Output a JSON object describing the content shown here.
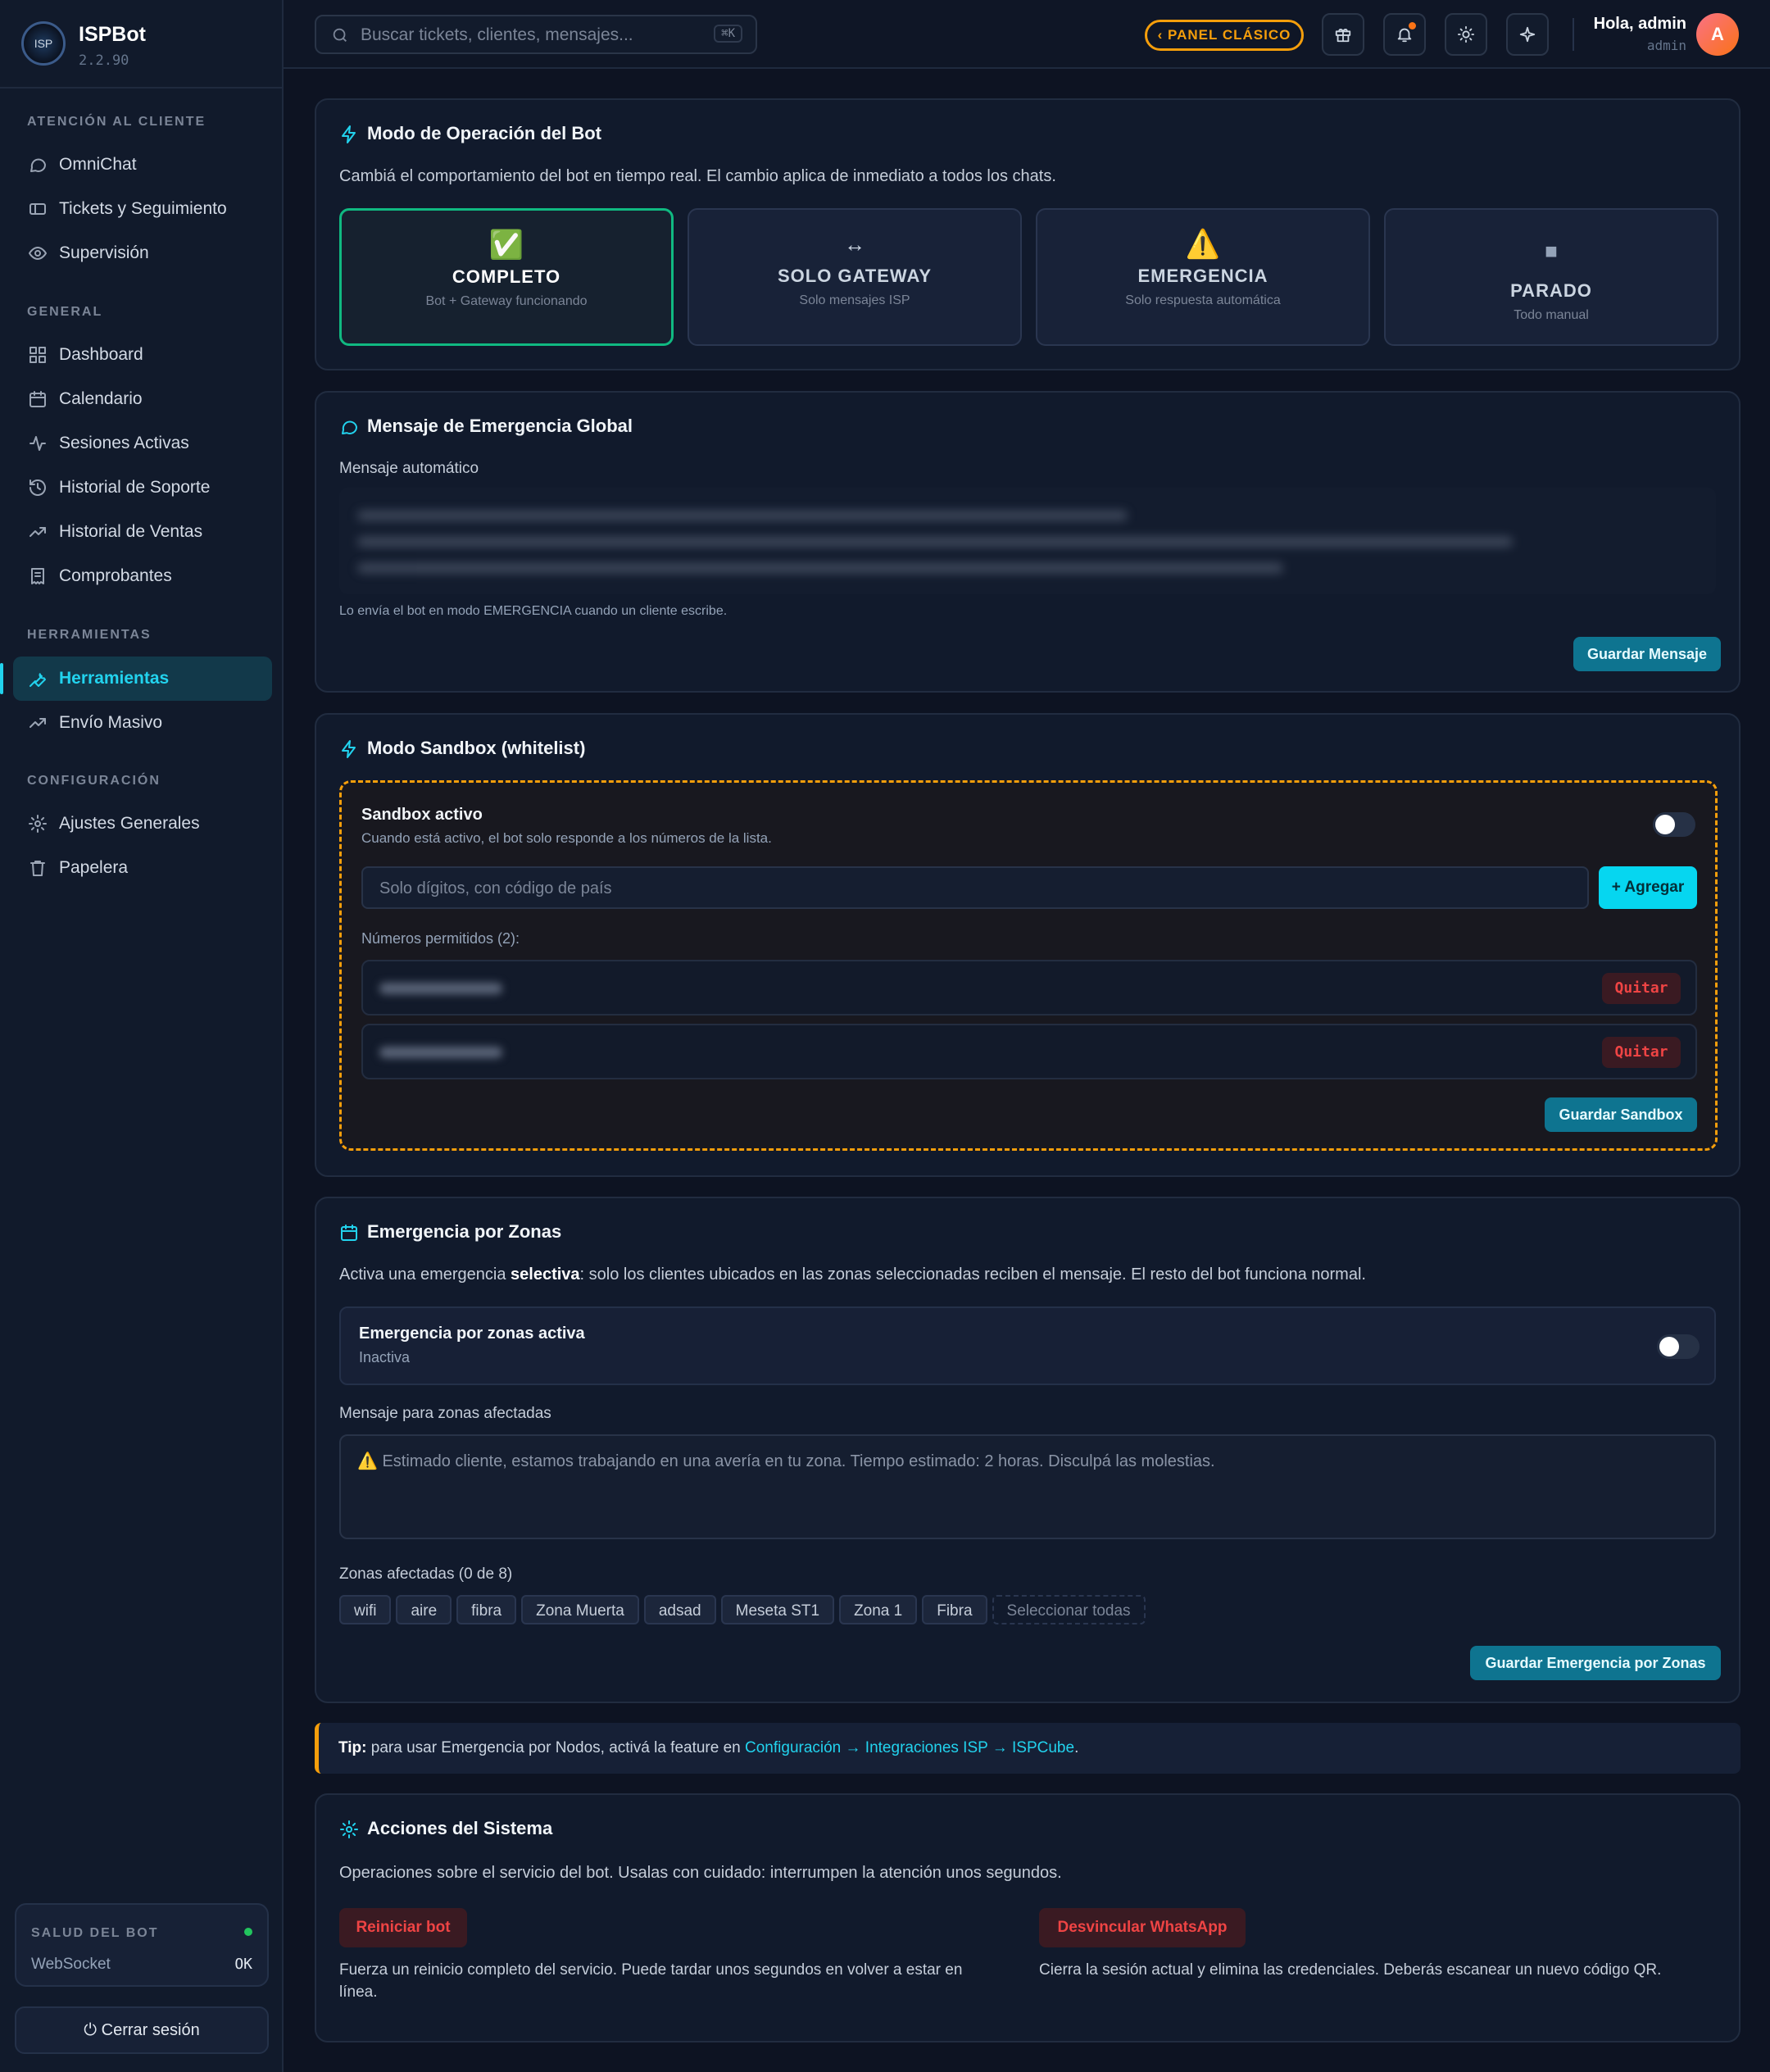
{
  "app": {
    "name": "ISPBot",
    "version": "2.2.90"
  },
  "sidebar": {
    "sections": [
      {
        "title": "ATENCIÓN AL CLIENTE",
        "items": [
          "OmniChat",
          "Tickets y Seguimiento",
          "Supervisión"
        ]
      },
      {
        "title": "GENERAL",
        "items": [
          "Dashboard",
          "Calendario",
          "Sesiones Activas",
          "Historial de Soporte",
          "Historial de Ventas",
          "Comprobantes"
        ]
      },
      {
        "title": "HERRAMIENTAS",
        "items": [
          "Herramientas",
          "Envío Masivo"
        ]
      },
      {
        "title": "CONFIGURACIÓN",
        "items": [
          "Ajustes Generales",
          "Papelera"
        ]
      }
    ],
    "active_item": "Herramientas",
    "health": {
      "title": "SALUD DEL BOT",
      "key": "WebSocket",
      "value": "OK",
      "status_color": "#22c55e"
    },
    "logout": "⏻ Cerrar sesión"
  },
  "topbar": {
    "search_placeholder": "Buscar tickets, clientes, mensajes...",
    "shortcut": "⌘K",
    "classic_panel": "‹ PANEL CLÁSICO",
    "greeting": "Hola, admin",
    "username": "admin",
    "avatar_letter": "A",
    "icons": [
      "gift-icon",
      "bell-icon",
      "sun-icon",
      "sparkle-icon"
    ]
  },
  "mode_card": {
    "title": "Modo de Operación del Bot",
    "description": "Cambiá el comportamiento del bot en tiempo real. El cambio aplica de inmediato a todos los chats.",
    "modes": [
      {
        "icon": "✅",
        "name": "COMPLETO",
        "sub": "Bot + Gateway funcionando",
        "selected": true
      },
      {
        "icon": "↔",
        "name": "SOLO GATEWAY",
        "sub": "Solo mensajes ISP",
        "selected": false
      },
      {
        "icon": "⚠️",
        "name": "EMERGENCIA",
        "sub": "Solo respuesta automática",
        "selected": false
      },
      {
        "icon": "■",
        "name": "PARADO",
        "sub": "Todo manual",
        "selected": false
      }
    ]
  },
  "emergency_card": {
    "title": "Mensaje de Emergencia Global",
    "label": "Mensaje automático",
    "help": "Lo envía el bot en modo EMERGENCIA cuando un cliente escribe.",
    "save": "Guardar Mensaje"
  },
  "sandbox_card": {
    "title": "Modo Sandbox (whitelist)",
    "toggle_title": "Sandbox activo",
    "toggle_desc": "Cuando está activo, el bot solo responde a los números de la lista.",
    "input_placeholder": "Solo dígitos, con código de país",
    "add": "+ Agregar",
    "allowed_label": "Números permitidos (2):",
    "remove": "Quitar",
    "save": "Guardar Sandbox",
    "accent": "#f59e0b"
  },
  "zones_card": {
    "title": "Emergencia por Zonas",
    "desc_pre": "Activa una emergencia ",
    "desc_bold": "selectiva",
    "desc_post": ": solo los clientes ubicados en las zonas seleccionadas reciben el mensaje. El resto del bot funciona normal.",
    "toggle_title": "Emergencia por zonas activa",
    "toggle_status": "Inactiva",
    "msg_label": "Mensaje para zonas afectadas",
    "msg_placeholder": "⚠️ Estimado cliente, estamos trabajando en una avería en tu zona. Tiempo estimado: 2 horas. Disculpá las molestias.",
    "zones_label": "Zonas afectadas (0 de 8)",
    "zones": [
      "wifi",
      "aire",
      "fibra",
      "Zona Muerta",
      "adsad",
      "Meseta ST1",
      "Zona 1",
      "Fibra"
    ],
    "select_all": "Seleccionar todas",
    "save": "Guardar Emergencia por Zonas"
  },
  "tip": {
    "bold": "Tip:",
    "text": " para usar Emergencia por Nodos, activá la feature en ",
    "link": "Configuración → Integraciones ISP → ISPCube",
    "end": "."
  },
  "actions_card": {
    "title": "Acciones del Sistema",
    "description": "Operaciones sobre el servicio del bot. Usalas con cuidado: interrumpen la atención unos segundos.",
    "restart": "Reiniciar bot",
    "restart_desc": "Fuerza un reinicio completo del servicio. Puede tardar unos segundos en volver a estar en línea.",
    "unlink": "Desvincular WhatsApp",
    "unlink_desc": "Cierra la sesión actual y elimina las credenciales. Deberás escanear un nuevo código QR."
  }
}
